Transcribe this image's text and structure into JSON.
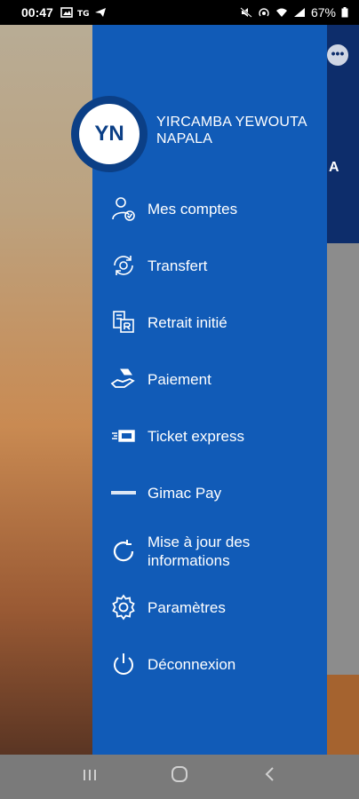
{
  "status_bar": {
    "time": "00:47",
    "battery": "67%"
  },
  "user": {
    "initials": "YN",
    "name_line1": "YIRCAMBA YEWOUTA",
    "name_line2": "NAPALA"
  },
  "menu": [
    {
      "label": "Mes comptes",
      "icon": "account-check-icon"
    },
    {
      "label": "Transfert",
      "icon": "transfer-icon"
    },
    {
      "label": "Retrait initié",
      "icon": "withdrawal-icon"
    },
    {
      "label": "Paiement",
      "icon": "payment-hand-icon"
    },
    {
      "label": "Ticket express",
      "icon": "ticket-express-icon"
    },
    {
      "label": "Gimac Pay",
      "icon": "gimac-logo-icon"
    },
    {
      "label_line1": "Mise à jour des",
      "label_line2": "informations",
      "icon": "refresh-icon"
    },
    {
      "label": "Paramètres",
      "icon": "settings-gear-icon"
    },
    {
      "label": "Déconnexion",
      "icon": "power-icon"
    }
  ],
  "background": {
    "letter": "A",
    "more_button": "•••"
  },
  "colors": {
    "drawer": "#115bb7",
    "avatar_ring": "#0b3f86",
    "navbar": "#7a7a7a"
  }
}
